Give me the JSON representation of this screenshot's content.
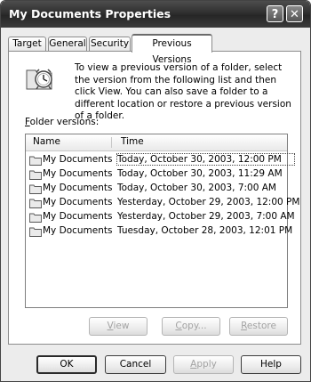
{
  "window": {
    "title": "My Documents Properties",
    "help_glyph": "?",
    "close_glyph": "✕"
  },
  "tabs": [
    "Target",
    "General",
    "Security",
    "Previous Versions"
  ],
  "active_tab": "Previous Versions",
  "intro": {
    "icon": "folder-clock-icon",
    "text": "To view a previous version of a folder, select the version from the following list and then click View. You can also save a folder to a different location or restore a previous version of a folder."
  },
  "versions": {
    "label_accel": "F",
    "label_rest": "older versions:",
    "columns": [
      "Name",
      "Time"
    ],
    "rows": [
      {
        "name": "My Documents",
        "time": "Today, October 30, 2003, 12:00 PM"
      },
      {
        "name": "My Documents",
        "time": "Today, October 30, 2003, 11:29 AM"
      },
      {
        "name": "My Documents",
        "time": "Today, October 30, 2003, 7:00 AM"
      },
      {
        "name": "My Documents",
        "time": "Yesterday, October 29, 2003, 12:00 PM"
      },
      {
        "name": "My Documents",
        "time": "Yesterday, October 29, 2003, 7:00 AM"
      },
      {
        "name": "My Documents",
        "time": "Tuesday, October 28, 2003, 12:01 PM"
      }
    ]
  },
  "panel_buttons": {
    "view": {
      "accel": "V",
      "rest": "iew"
    },
    "copy": {
      "accel": "C",
      "rest": "opy..."
    },
    "restore": {
      "accel": "R",
      "rest": "estore"
    }
  },
  "dialog_buttons": {
    "ok": "OK",
    "cancel": "Cancel",
    "apply": {
      "accel": "A",
      "rest": "pply"
    },
    "help": "Help"
  }
}
